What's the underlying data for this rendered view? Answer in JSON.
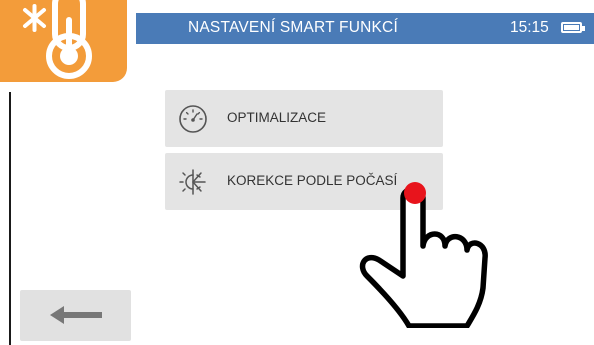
{
  "header": {
    "title": "NASTAVENÍ SMART FUNKCÍ",
    "time": "15:15",
    "color": "#4a7bb7"
  },
  "app_icon": {
    "icon": "thermometer-icon",
    "color": "#f39c3a"
  },
  "menu": {
    "items": [
      {
        "label": "OPTIMALIZACE",
        "icon": "gauge-icon"
      },
      {
        "label": "KOREKCE PODLE POČASÍ",
        "icon": "sun-snowflake-icon"
      }
    ]
  },
  "back": {
    "icon": "arrow-left-icon"
  },
  "pointer": {
    "icon": "pointing-hand-icon",
    "touch_color": "#e8141c"
  }
}
